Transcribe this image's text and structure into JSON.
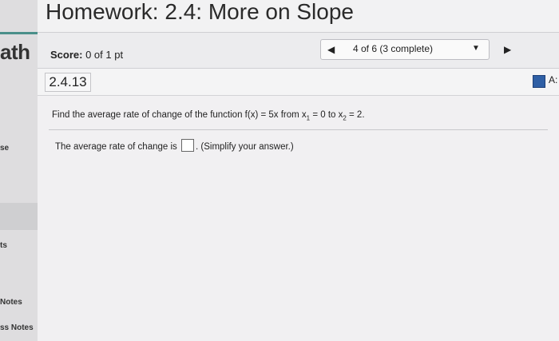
{
  "header": {
    "title": "Homework: 2.4: More on Slope"
  },
  "sidebar": {
    "app_label": "ath",
    "items": [
      "se",
      "ts",
      "Notes",
      "ss Notes"
    ]
  },
  "scorebar": {
    "score_label": "Score:",
    "score_value": "0 of 1 pt",
    "nav_label": "4 of 6 (3 complete)",
    "prev_symbol": "◀",
    "next_symbol": "▶",
    "caret_symbol": "▼"
  },
  "question": {
    "id": "2.4.13",
    "tool_label": "A:",
    "instruction_prefix": "Find the average rate of change of the function f(x) = 5x from x",
    "sub1": "1",
    "instruction_mid": " = 0 to x",
    "sub2": "2",
    "instruction_suffix": " = 2.",
    "answer_prefix": "The average rate of change is",
    "answer_suffix": ". (Simplify your answer.)"
  },
  "colors": {
    "accent_rule": "#4a8f8a",
    "tool_button": "#2f5fa5"
  }
}
